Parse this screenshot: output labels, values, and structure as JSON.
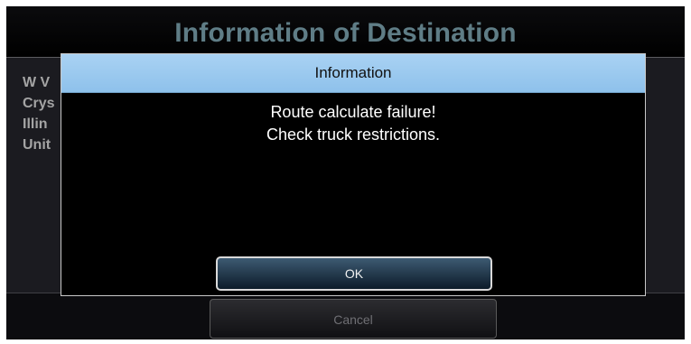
{
  "screen": {
    "title": "Information of Destination",
    "address_lines": [
      "W V",
      "Crys",
      "Illin",
      "Unit"
    ],
    "cancel_label": "Cancel"
  },
  "dialog": {
    "title": "Information",
    "message_lines": [
      "Route calculate failure!",
      "Check truck restrictions."
    ],
    "ok_label": "OK"
  },
  "colors": {
    "dialog_title_bar": "#A9D2F3",
    "page_title": "#5F7D86",
    "address_text": "#A4A4A4"
  }
}
